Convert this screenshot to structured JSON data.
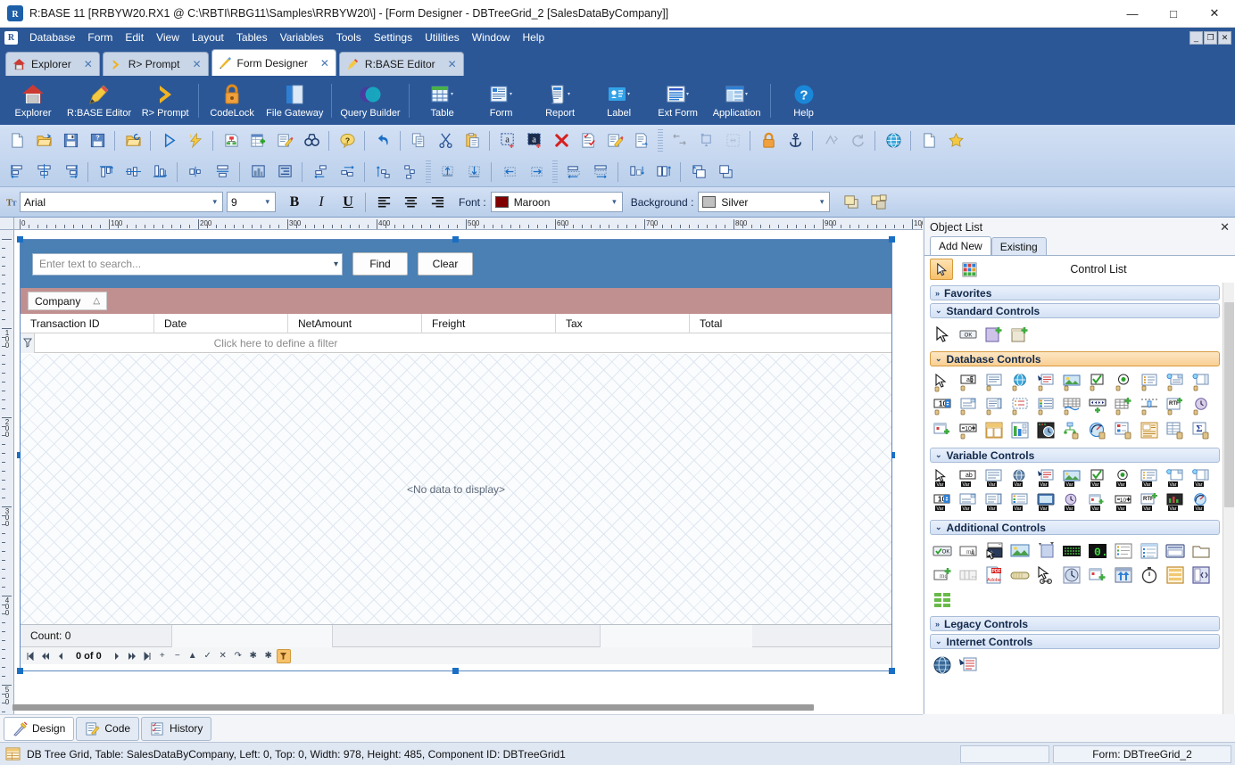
{
  "window": {
    "title": "R:BASE 11 [RRBYW20.RX1 @ C:\\RBTI\\RBG11\\Samples\\RRBYW20\\] - [Form Designer - DBTreeGrid_2 [SalesDataByCompany]]",
    "minimize": "—",
    "maximize": "□",
    "close": "✕",
    "app_logo": "R"
  },
  "menubar": {
    "logo": "R",
    "items": [
      "Database",
      "Form",
      "Edit",
      "View",
      "Layout",
      "Tables",
      "Variables",
      "Tools",
      "Settings",
      "Utilities",
      "Window",
      "Help"
    ],
    "mdi": {
      "minimize": "_",
      "restore": "❐",
      "close": "✕"
    }
  },
  "doc_tabs": [
    {
      "label": "Explorer",
      "icon": "house-icon",
      "close": "✕",
      "active": false
    },
    {
      "label": "R> Prompt",
      "icon": "chevron-right-icon",
      "close": "✕",
      "active": false
    },
    {
      "label": "Form Designer",
      "icon": "pencil-ruler-icon",
      "close": "✕",
      "active": true
    },
    {
      "label": "R:BASE Editor",
      "icon": "pen-icon",
      "close": "✕",
      "active": false
    }
  ],
  "big_toolbar": [
    {
      "label": "Explorer",
      "icon": "house-icon",
      "dropdown": false
    },
    {
      "label": "R:BASE Editor",
      "icon": "pen-icon",
      "dropdown": false
    },
    {
      "label": "R> Prompt",
      "icon": "chevron-right-icon",
      "dropdown": false
    },
    {
      "label": "CodeLock",
      "icon": "padlock-icon",
      "dropdown": false
    },
    {
      "label": "File Gateway",
      "icon": "documents-icon",
      "dropdown": false
    },
    {
      "label": "Query Builder",
      "icon": "venn-circles-icon",
      "dropdown": false
    },
    {
      "label": "Table",
      "icon": "table-grid-icon",
      "dropdown": true
    },
    {
      "label": "Form",
      "icon": "form-icon",
      "dropdown": true
    },
    {
      "label": "Report",
      "icon": "report-scroll-icon",
      "dropdown": true
    },
    {
      "label": "Label",
      "icon": "badge-icon",
      "dropdown": true
    },
    {
      "label": "Ext Form",
      "icon": "ext-form-icon",
      "dropdown": true
    },
    {
      "label": "Application",
      "icon": "application-icon",
      "dropdown": true
    },
    {
      "label": "Help",
      "icon": "question-circle-icon",
      "dropdown": false
    }
  ],
  "small_toolbar_row1": [
    "new-document-icon",
    "open-folder-icon",
    "save-disk-icon",
    "save-as-disk-icon",
    "sep",
    "open-recent-folder-icon",
    "sep",
    "run-play-icon",
    "run-lightning-icon",
    "sep",
    "structure-tree-icon",
    "table-add-icon",
    "edit-document-icon",
    "binoculars-find-icon",
    "sep",
    "help-balloon-icon",
    "sep",
    "undo-arrow-icon",
    "sep",
    "copy-icon",
    "cut-scissors-icon",
    "paste-icon",
    "sep",
    "insert-object-icon",
    "insert-object-dark-icon",
    "delete-x-icon",
    "properties-check-icon",
    "edit-note-icon",
    "export-doc-icon",
    "grip",
    "align-left-edge-icon",
    "size-to-grid-icon",
    "scale-icon",
    "sep",
    "lock-controls-icon",
    "anchor-icon",
    "sep",
    "tab-order-icon",
    "refresh-icon",
    "sep",
    "globe-web-icon",
    "sep",
    "page-icon",
    "favorites-star-icon"
  ],
  "small_toolbar_row2": [
    "align-left-icon",
    "align-center-horiz-icon",
    "align-right-icon",
    "sep",
    "align-top-icon",
    "align-middle-icon",
    "align-bottom-icon",
    "sep",
    "center-horizontally-icon",
    "center-vertically-icon",
    "sep",
    "equalize-width-icon",
    "equalize-height-icon",
    "sep",
    "space-horizontally-icon",
    "space-equal-horiz-icon",
    "sep",
    "space-vertically-icon",
    "space-equal-vert-icon",
    "grip",
    "nudge-up-icon",
    "nudge-down-icon",
    "sep",
    "nudge-left-icon",
    "nudge-right-icon",
    "grip",
    "size-width-icon",
    "size-height-icon",
    "sep",
    "shrink-height-icon",
    "grow-height-icon",
    "sep",
    "bring-front-icon",
    "send-back-icon"
  ],
  "font_toolbar": {
    "font_icon": "font-tt-icon",
    "font_name": "Arial",
    "font_size": "9",
    "bold": "B",
    "italic": "I",
    "underline": "U",
    "align_left": "align-left-icon",
    "align_center": "align-center-icon",
    "align_right": "align-right-icon",
    "font_color_label": "Font :",
    "font_color_value": "Maroon",
    "font_color_hex": "#800000",
    "background_label": "Background :",
    "background_value": "Silver",
    "background_hex": "#c0c0c0",
    "bring_to_front": "bring-to-front-icon",
    "send_to_back": "send-to-back-icon"
  },
  "designer": {
    "ruler_h_labels": [
      "0",
      "100",
      "200",
      "300",
      "400",
      "500",
      "600",
      "700",
      "800",
      "900",
      "1000"
    ],
    "ruler_v_labels": [
      "0",
      "100",
      "200",
      "300",
      "400",
      "500"
    ],
    "search": {
      "placeholder": "Enter text to search...",
      "dropdown_arrow": "⌄",
      "find_label": "Find",
      "clear_label": "Clear"
    },
    "group_panel": {
      "chip_label": "Company",
      "sort_arrow": "△"
    },
    "columns": [
      "Transaction ID",
      "Date",
      "NetAmount",
      "Freight",
      "Tax",
      "Total"
    ],
    "filter_row": {
      "icon": "filter-funnel-icon",
      "text": "Click here to define a filter"
    },
    "body_message": "<No data to display>",
    "count_label": "Count: 0",
    "navigator": {
      "first": "⏮",
      "prior_page": "⏪",
      "prior": "◀",
      "position": "0 of 0",
      "next": "▶",
      "next_page": "⏩",
      "last": "⏭",
      "insert": "+",
      "delete": "−",
      "edit": "▲",
      "post": "✓",
      "cancel": "✕",
      "refresh": "↷",
      "apply": "✱",
      "save": "✱",
      "filter": "filter-funnel-icon"
    }
  },
  "object_list": {
    "title": "Object List",
    "close": "✕",
    "tabs": [
      {
        "label": "Add New",
        "active": true
      },
      {
        "label": "Existing",
        "active": false
      }
    ],
    "tools": [
      "pointer-arrow-icon",
      "color-grid-icon"
    ],
    "control_list_label": "Control List",
    "categories": [
      {
        "name": "Favorites",
        "collapsed": true,
        "chevron": "»",
        "style": "blue",
        "icons": []
      },
      {
        "name": "Standard Controls",
        "collapsed": false,
        "chevron": "⌄",
        "style": "blue",
        "icons": [
          "pointer-arrow-icon",
          "ok-button-icon",
          "panel-add-icon",
          "group-add-icon"
        ]
      },
      {
        "name": "Database Controls",
        "collapsed": false,
        "chevron": "⌄",
        "style": "orange",
        "icons": [
          "db-pointer-icon",
          "db-text-field-icon",
          "db-memo-icon",
          "db-web-icon",
          "db-richview-icon",
          "db-image-icon",
          "db-checkbox-icon",
          "db-radio-icon",
          "db-listbox-icon",
          "db-lookup-icon",
          "db-combo-icon",
          "db-spin-icon",
          "db-dropdown-icon",
          "db-list-sel-icon",
          "db-multi-icon",
          "db-detail-grid-icon",
          "db-grid-icon",
          "db-navigator-icon",
          "db-grid-add-icon",
          "db-slider-icon",
          "db-rtf-add-icon",
          "db-clock-icon",
          "db-calendar-add-icon",
          "db-numeric-icon",
          "db-layout-icon",
          "db-chart-icon",
          "db-timer-icon",
          "db-tree-icon",
          "db-gauge-icon",
          "db-diagram-icon",
          "db-report-icon",
          "db-table-icon",
          "db-summary-icon"
        ]
      },
      {
        "name": "Variable Controls",
        "collapsed": false,
        "chevron": "⌄",
        "style": "blue",
        "icons": [
          "var-pointer-icon",
          "var-text-field-icon",
          "var-memo-icon",
          "var-web-icon",
          "var-richview-icon",
          "var-image-icon",
          "var-checkbox-icon",
          "var-radio-icon",
          "var-listbox-icon",
          "var-lookup-icon",
          "var-combo-icon",
          "var-spin-icon",
          "var-dropdown-icon",
          "var-list-sel-icon",
          "var-multi-icon",
          "var-screen-icon",
          "var-clock-icon",
          "var-calendar-icon",
          "var-numeric-icon",
          "var-rtf-icon",
          "var-chart-icon",
          "var-gauge-icon"
        ]
      },
      {
        "name": "Additional Controls",
        "collapsed": false,
        "chevron": "⌄",
        "style": "blue",
        "icons": [
          "add-ok-button-icon",
          "add-mask-icon",
          "add-combo-list-icon",
          "add-image-icon",
          "add-shape-icon",
          "add-led-grid-icon",
          "add-seven-seg-icon",
          "add-checklist-icon",
          "add-listview-icon",
          "add-panel-icon",
          "add-folder-icon",
          "add-mask-plus-icon",
          "add-separator-icon",
          "add-pdf-icon",
          "add-progress-icon",
          "add-pointer-icon",
          "add-clock-icon",
          "add-calendar-plus-icon",
          "add-upload-icon",
          "add-stopwatch-icon",
          "add-form-layout-icon",
          "add-splitter-icon",
          "add-tile-icon"
        ]
      },
      {
        "name": "Legacy Controls",
        "collapsed": true,
        "chevron": "»",
        "style": "blue",
        "icons": []
      },
      {
        "name": "Internet Controls",
        "collapsed": false,
        "chevron": "⌄",
        "style": "blue",
        "icons": [
          "net-globe-icon",
          "net-richview-icon"
        ]
      }
    ]
  },
  "bottom_tabs": [
    {
      "label": "Design",
      "icon": "design-ruler-icon",
      "active": true
    },
    {
      "label": "Code",
      "icon": "code-pencil-icon",
      "active": false
    },
    {
      "label": "History",
      "icon": "history-list-icon",
      "active": false
    }
  ],
  "statusbar": {
    "icon": "grid-component-icon",
    "text": "DB Tree Grid, Table: SalesDataByCompany, Left: 0, Top: 0, Width: 978, Height: 485, Component ID: DBTreeGrid1",
    "form_label": "Form: DBTreeGrid_2"
  },
  "colors": {
    "chrome_blue": "#2b5797",
    "toolbar_blue": "#c6d6ef",
    "search_band": "#4a80b4",
    "group_band": "#c09090",
    "accent_orange": "#f7c16b",
    "selection_handle": "#1a6fc4"
  }
}
